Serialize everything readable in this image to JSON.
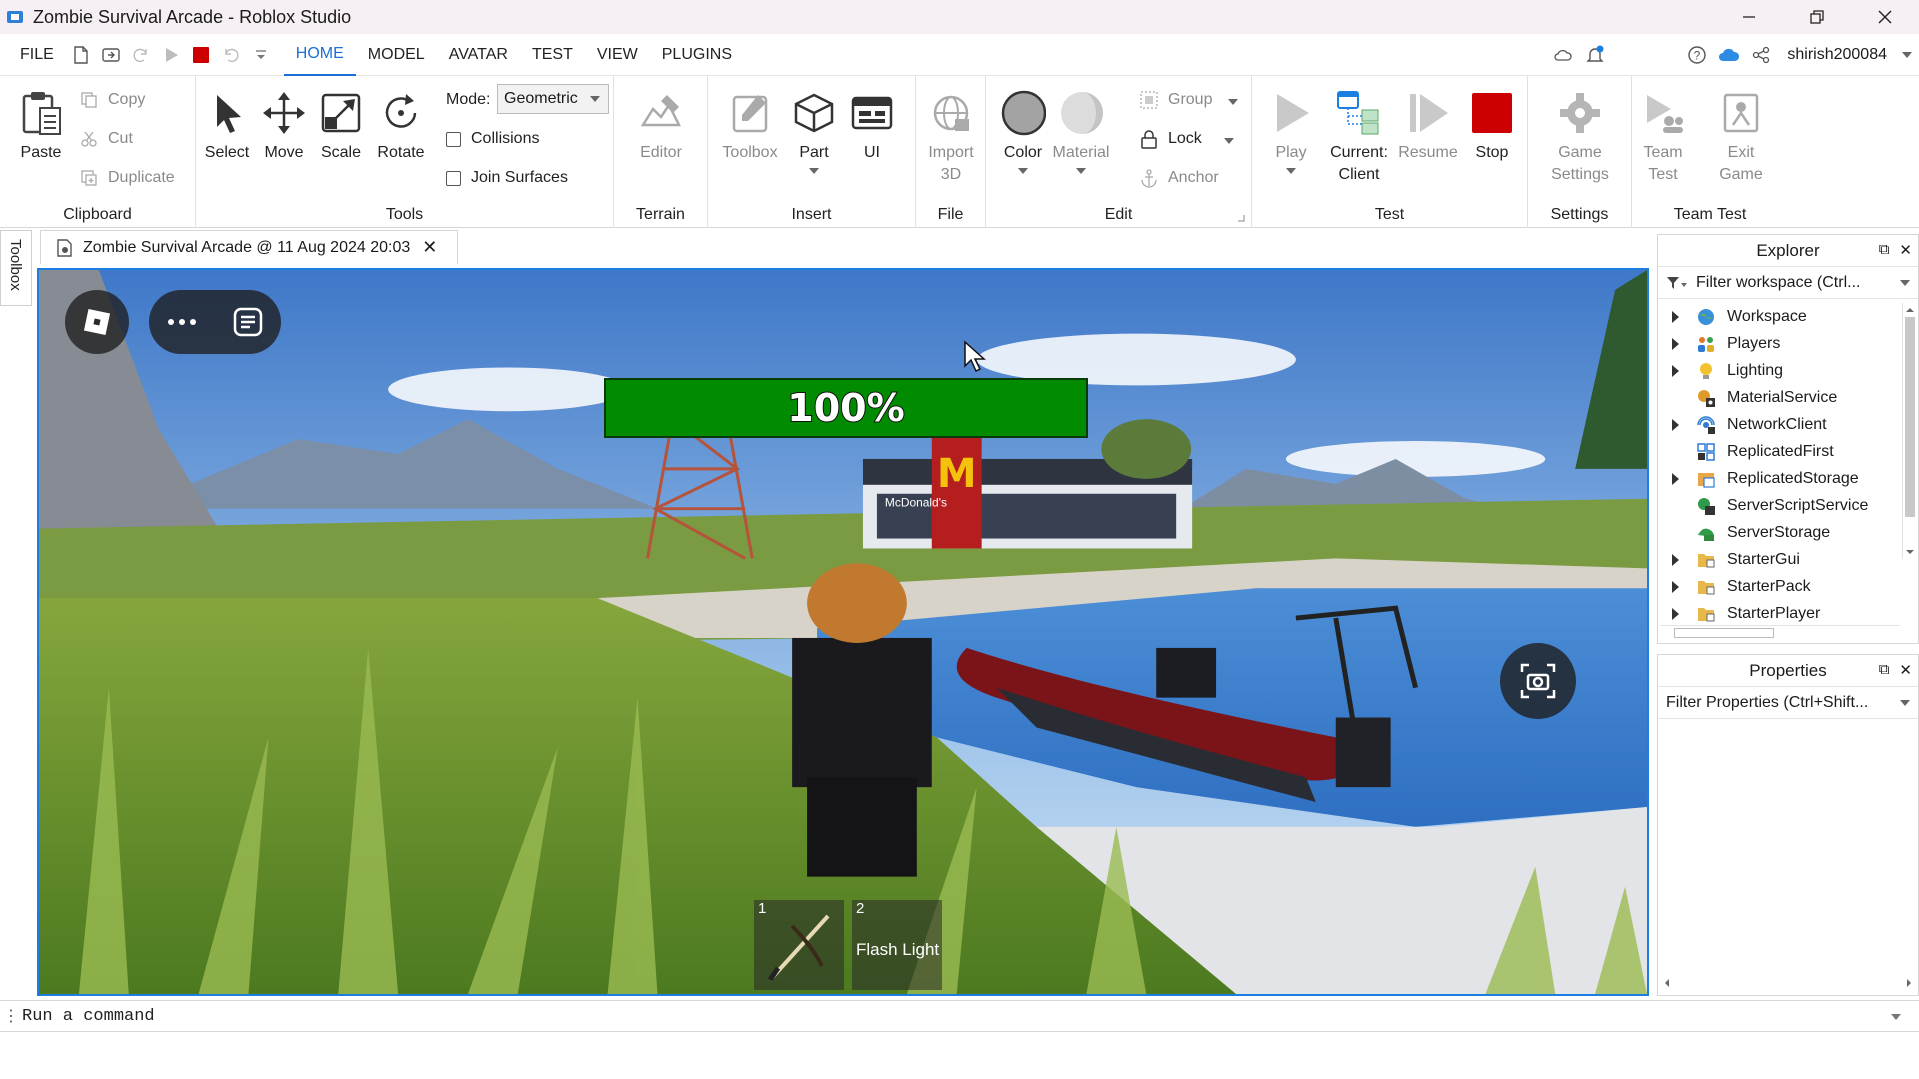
{
  "window": {
    "title": "Zombie Survival Arcade - Roblox Studio",
    "controls": [
      "minimize",
      "restore",
      "close"
    ]
  },
  "menubar": {
    "file": "FILE",
    "tabs": [
      "HOME",
      "MODEL",
      "AVATAR",
      "TEST",
      "VIEW",
      "PLUGINS"
    ],
    "active_tab": "HOME",
    "username": "shirish200084"
  },
  "ribbon": {
    "clipboard": {
      "label": "Clipboard",
      "paste": "Paste",
      "copy": "Copy",
      "cut": "Cut",
      "duplicate": "Duplicate"
    },
    "tools": {
      "label": "Tools",
      "select": "Select",
      "move": "Move",
      "scale": "Scale",
      "rotate": "Rotate",
      "mode_label": "Mode:",
      "mode_value": "Geometric",
      "collisions": "Collisions",
      "join_surfaces": "Join Surfaces"
    },
    "terrain": {
      "label": "Terrain",
      "editor": "Editor"
    },
    "insert": {
      "label": "Insert",
      "toolbox": "Toolbox",
      "part": "Part",
      "ui": "UI"
    },
    "file": {
      "label": "File",
      "import_line1": "Import",
      "import_line2": "3D"
    },
    "edit": {
      "label": "Edit",
      "color": "Color",
      "material": "Material",
      "group": "Group",
      "lock": "Lock",
      "anchor": "Anchor"
    },
    "test": {
      "label": "Test",
      "play": "Play",
      "current_line1": "Current:",
      "current_line2": "Client",
      "resume": "Resume",
      "stop": "Stop"
    },
    "settings": {
      "label": "Settings",
      "game_line1": "Game",
      "game_line2": "Settings"
    },
    "team_test": {
      "label": "Team Test",
      "team_line1": "Team",
      "team_line2": "Test",
      "exit_line1": "Exit",
      "exit_line2": "Game"
    }
  },
  "left_rail": {
    "toolbox": "Toolbox"
  },
  "document_tab": {
    "label": "Zombie Survival Arcade @ 11 Aug 2024 20:03"
  },
  "viewport": {
    "health_text": "100%",
    "hotbar": [
      {
        "slot": "1",
        "label": ""
      },
      {
        "slot": "2",
        "label": "Flash Light"
      }
    ],
    "store_sign": "McDonald's"
  },
  "explorer": {
    "title": "Explorer",
    "filter_placeholder": "Filter workspace (Ctrl...",
    "items": [
      {
        "name": "Workspace",
        "expandable": true,
        "icon": "globe-icon"
      },
      {
        "name": "Players",
        "expandable": true,
        "icon": "players-icon"
      },
      {
        "name": "Lighting",
        "expandable": true,
        "icon": "lightbulb-icon"
      },
      {
        "name": "MaterialService",
        "expandable": false,
        "icon": "material-service-icon"
      },
      {
        "name": "NetworkClient",
        "expandable": true,
        "icon": "network-icon"
      },
      {
        "name": "ReplicatedFirst",
        "expandable": false,
        "icon": "replicated-first-icon"
      },
      {
        "name": "ReplicatedStorage",
        "expandable": true,
        "icon": "replicated-storage-icon"
      },
      {
        "name": "ServerScriptService",
        "expandable": false,
        "icon": "server-script-icon"
      },
      {
        "name": "ServerStorage",
        "expandable": false,
        "icon": "server-storage-icon"
      },
      {
        "name": "StarterGui",
        "expandable": true,
        "icon": "folder-icon"
      },
      {
        "name": "StarterPack",
        "expandable": true,
        "icon": "folder-icon"
      },
      {
        "name": "StarterPlayer",
        "expandable": true,
        "icon": "folder-icon"
      }
    ]
  },
  "properties": {
    "title": "Properties",
    "filter_placeholder": "Filter Properties (Ctrl+Shift..."
  },
  "command_bar": {
    "placeholder": "Run a command"
  },
  "colors": {
    "accent": "#1a6fd8",
    "health_green": "#018b01",
    "stop_red": "#cc0000",
    "titlebar_bg": "#f6eff3"
  }
}
